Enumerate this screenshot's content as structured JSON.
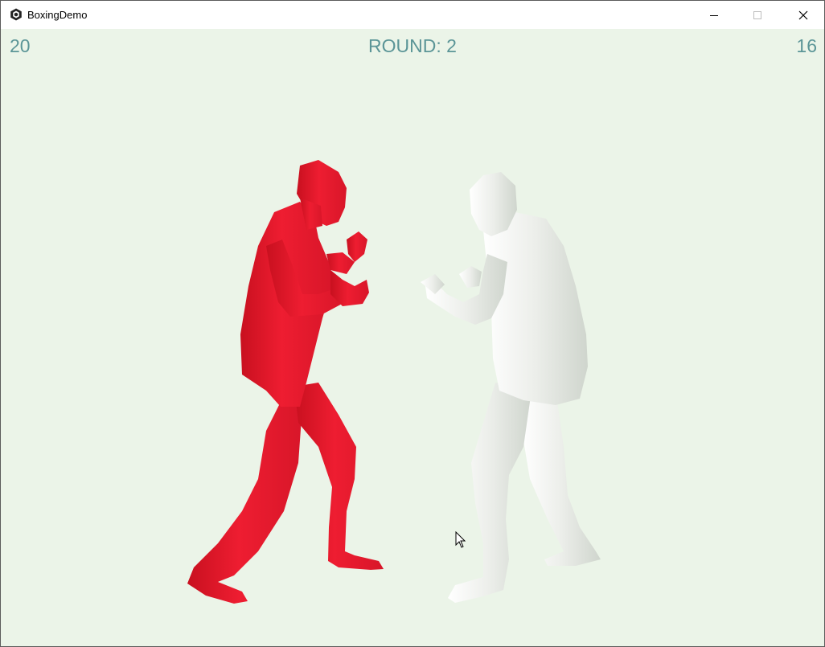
{
  "window": {
    "title": "BoxingDemo",
    "icon": "unity-icon",
    "controls": [
      "minimize",
      "maximize",
      "close"
    ]
  },
  "hud": {
    "player_score": "20",
    "round_label": "ROUND: 2",
    "opponent_score": "16"
  },
  "scene": {
    "background_color": "#ebf4e8",
    "hud_color": "#5b9597",
    "fighters": [
      {
        "name": "red fighter",
        "color": "#e81c2f"
      },
      {
        "name": "white fighter",
        "color": "#e8ece6"
      }
    ]
  }
}
